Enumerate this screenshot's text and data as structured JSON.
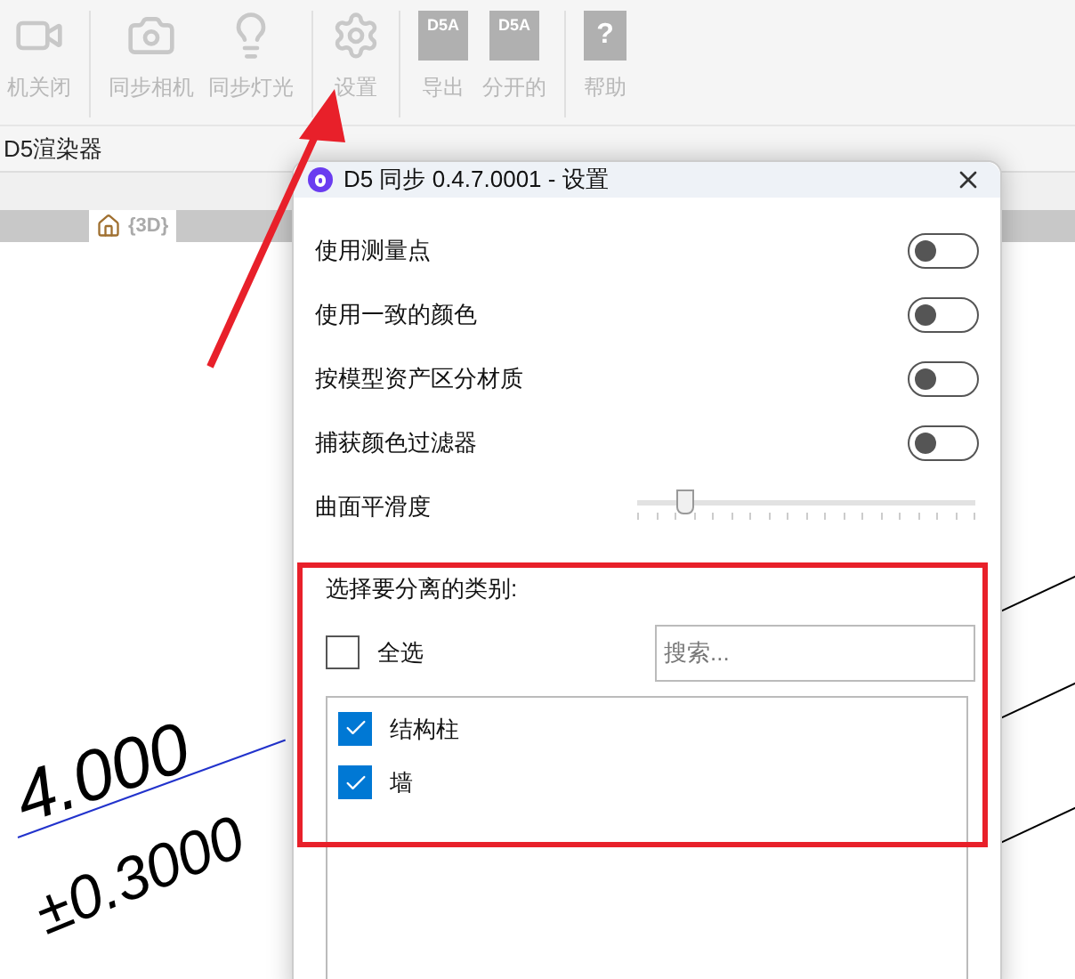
{
  "toolbar": [
    {
      "kind": "video",
      "label": "机关闭"
    },
    {
      "kind": "camera",
      "label": "同步相机"
    },
    {
      "kind": "bulb",
      "label": "同步灯光"
    },
    {
      "kind": "gear",
      "label": "设置"
    },
    {
      "kind": "doc",
      "label": "导出",
      "badge": "D5A"
    },
    {
      "kind": "doc",
      "label": "分开的",
      "badge": "D5A"
    },
    {
      "kind": "help",
      "label": "帮助",
      "badge": "?"
    }
  ],
  "ribbon_group": "D5渲染器",
  "view_tab": "{3D}",
  "canvas_labels": [
    "4.000",
    "±0.3000"
  ],
  "dialog": {
    "title": "D5 同步 0.4.7.0001 - 设置",
    "toggles": [
      {
        "label": "使用测量点",
        "on": false
      },
      {
        "label": "使用一致的颜色",
        "on": false
      },
      {
        "label": "按模型资产区分材质",
        "on": false
      },
      {
        "label": "捕获颜色过滤器",
        "on": false
      }
    ],
    "slider": {
      "label": "曲面平滑度",
      "level": 0.14
    },
    "categories": {
      "heading": "选择要分离的类别:",
      "select_all": {
        "label": "全选",
        "checked": false
      },
      "search": {
        "placeholder": "搜索..."
      },
      "items": [
        {
          "label": "结构柱",
          "checked": true
        },
        {
          "label": "墙",
          "checked": true
        }
      ]
    }
  }
}
